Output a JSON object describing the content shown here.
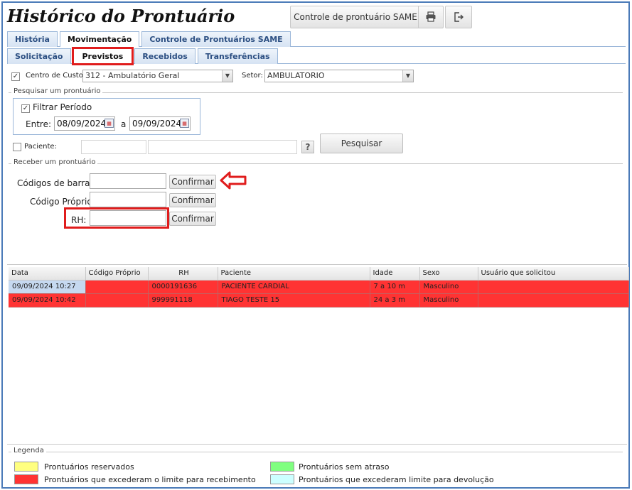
{
  "header": {
    "title": "Histórico do Prontuário",
    "same_button": "Controle de prontuário SAME"
  },
  "main_tabs": [
    {
      "label": "História"
    },
    {
      "label": "Movimentação"
    },
    {
      "label": "Controle de Prontuários SAME"
    }
  ],
  "sub_tabs": [
    {
      "label": "Solicitação"
    },
    {
      "label": "Previstos"
    },
    {
      "label": "Recebidos"
    },
    {
      "label": "Transferências"
    }
  ],
  "filters": {
    "cost_center_label": "Centro de Custo:",
    "cost_center_value": "312 - Ambulatório Geral",
    "sector_label": "Setor:",
    "sector_value": "AMBULATORIO"
  },
  "search": {
    "legend": "Pesquisar um prontuário",
    "filter_period_label": "Filtrar Período",
    "between_label": "Entre:",
    "date_from": "08/09/2024",
    "and_label": "a",
    "date_to": "09/09/2024",
    "patient_label": "Paciente:",
    "help_label": "?",
    "search_button": "Pesquisar"
  },
  "receive": {
    "legend": "Receber um prontuário",
    "barcode_label": "Códigos de barras:",
    "own_code_label": "Código Próprio:",
    "rh_label": "RH:",
    "confirm_label": "Confirmar"
  },
  "table": {
    "columns": [
      "Data",
      "Código Próprio",
      "RH",
      "Paciente",
      "Idade",
      "Sexo",
      "Usuário que solicitou"
    ],
    "rows": [
      {
        "data": "09/09/2024 10:27",
        "codigo": "",
        "rh": "0000191636",
        "paciente": "PACIENTE CARDIAL",
        "idade": "7 a 10 m",
        "sexo": "Masculino",
        "usuario": ""
      },
      {
        "data": "09/09/2024 10:42",
        "codigo": "",
        "rh": "999991118",
        "paciente": "TIAGO TESTE 15",
        "idade": "24 a 3 m",
        "sexo": "Masculino",
        "usuario": ""
      }
    ]
  },
  "legend": {
    "title": "Legenda",
    "items": [
      {
        "label": "Prontuários reservados",
        "color": "#ffff80"
      },
      {
        "label": "Prontuários sem atraso",
        "color": "#80ff80"
      },
      {
        "label": "Prontuários que excederam o limite para recebimento",
        "color": "#ff3333"
      },
      {
        "label": "Prontuários que excederam limite para devolução",
        "color": "#ccffff"
      }
    ]
  },
  "colors": {
    "row_overdue": "#ff3333",
    "row_selected_cell": "#c6d9f0",
    "highlight": "#e01c1c"
  }
}
